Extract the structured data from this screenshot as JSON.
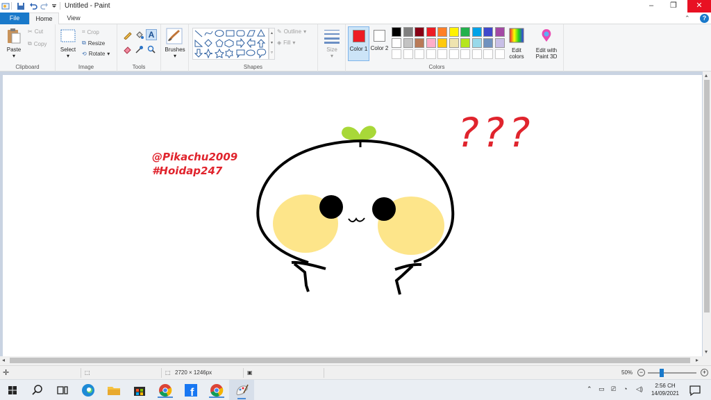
{
  "window": {
    "title": "Untitled - Paint",
    "minimize": "–",
    "restore": "❐",
    "close": "✕",
    "collapse": "⌃",
    "help": "?"
  },
  "tabs": {
    "file": "File",
    "home": "Home",
    "view": "View"
  },
  "ribbon": {
    "clipboard": {
      "label": "Clipboard",
      "paste": "Paste",
      "cut": "Cut",
      "copy": "Copy"
    },
    "image": {
      "label": "Image",
      "select": "Select",
      "crop": "Crop",
      "resize": "Resize",
      "rotate": "Rotate"
    },
    "tools": {
      "label": "Tools"
    },
    "brushes": {
      "label": "Brushes"
    },
    "shapes": {
      "label": "Shapes",
      "outline": "Outline",
      "fill": "Fill"
    },
    "size": {
      "label": "Size"
    },
    "colors": {
      "label": "Colors",
      "color1": "Color 1",
      "color2": "Color 2",
      "edit_colors": "Edit colors",
      "edit_paint3d": "Edit with Paint 3D",
      "color1_value": "#ed1c24",
      "color2_value": "#ffffff",
      "palette_row1": [
        "#000000",
        "#7f7f7f",
        "#880015",
        "#ed1c24",
        "#ff7f27",
        "#fff200",
        "#22b14c",
        "#00a2e8",
        "#3f48cc",
        "#a349a4"
      ],
      "palette_row2": [
        "#ffffff",
        "#c3c3c3",
        "#b97a57",
        "#ffaec9",
        "#ffc90e",
        "#efe4b0",
        "#b5e61d",
        "#99d9ea",
        "#7092be",
        "#c8bfe7"
      ],
      "palette_row3": [
        "#ffffff",
        "#ffffff",
        "#ffffff",
        "#ffffff",
        "#ffffff",
        "#ffffff",
        "#ffffff",
        "#ffffff",
        "#ffffff",
        "#ffffff"
      ]
    }
  },
  "canvas": {
    "handle": "@Pikachu2009",
    "hashtag": "#Hoidap247",
    "question": "???"
  },
  "status": {
    "dimensions": "2720 × 1246px",
    "zoom": "50%"
  },
  "taskbar": {
    "time": "2:56 CH",
    "date": "14/09/2021"
  }
}
